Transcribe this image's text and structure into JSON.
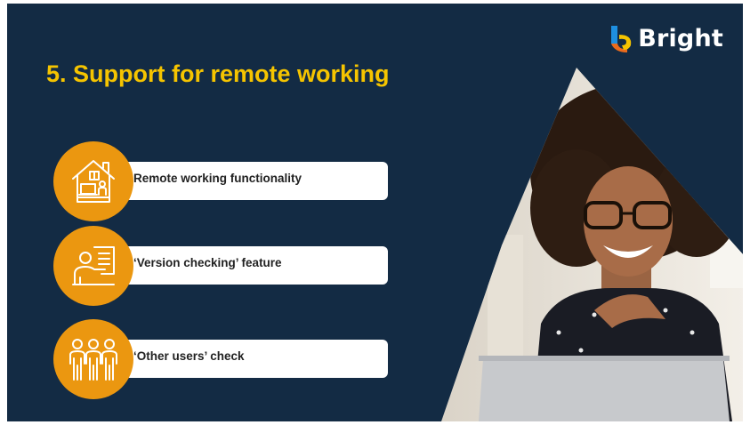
{
  "logo": {
    "name": "Bright",
    "icon": "bright-logo-mark",
    "colors": {
      "blue": "#1e8fe0",
      "yellow": "#f5c400",
      "orange": "#eb6b1c"
    }
  },
  "title": "5. Support for remote working",
  "features": [
    {
      "label": "Remote working functionality",
      "icon": "home-office-icon"
    },
    {
      "label": "‘Version checking’ feature",
      "icon": "presentation-icon"
    },
    {
      "label": "‘Other users’ check",
      "icon": "team-icon"
    }
  ],
  "colors": {
    "background": "#132b44",
    "accent": "#eb9710",
    "title": "#f5c400",
    "card": "#ffffff"
  },
  "photo": {
    "subject": "smiling-woman-with-glasses-and-laptop"
  }
}
